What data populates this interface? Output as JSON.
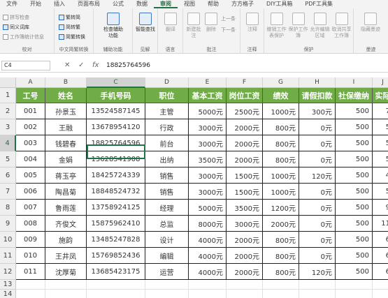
{
  "menu": {
    "tabs": [
      "文件",
      "开始",
      "插入",
      "页面布局",
      "公式",
      "数据",
      "审阅",
      "视图",
      "帮助",
      "方方格子",
      "DIY工具箱",
      "PDF工具集"
    ],
    "active": "审阅"
  },
  "ribbon": {
    "proofing": {
      "items": [
        "拼写检查",
        "同义词库",
        "工作簿统计信息"
      ],
      "label": "校对"
    },
    "chinese_conversion": {
      "items": [
        "繁转简",
        "简转繁",
        "简繁转换"
      ],
      "label": "中文简繁转换"
    },
    "accessibility": {
      "button": "检查辅助功能",
      "label": "辅助功能"
    },
    "insights": {
      "button": "智能查找",
      "label": "见解"
    },
    "language": {
      "button": "翻译",
      "label": "语言"
    },
    "comments": {
      "buttons": [
        "新建批注",
        "删除",
        "上一条",
        "下一条"
      ],
      "label": "批注"
    },
    "notes": {
      "button": "注释",
      "label": "注释"
    },
    "protect": {
      "buttons": [
        "撤销工作表保护",
        "保护工作簿",
        "允许编辑区域",
        "取消共享工作簿"
      ],
      "label": "保护"
    },
    "ink": {
      "button": "隐藏墨迹",
      "label": "墨迹"
    }
  },
  "formula_bar": {
    "name_box": "C4",
    "fx_label": "fx",
    "value": "18825764596"
  },
  "grid": {
    "columns": [
      "A",
      "B",
      "C",
      "D",
      "E",
      "F",
      "G",
      "H",
      "I",
      "J"
    ],
    "selected_column": "C",
    "rows": [
      "1",
      "2",
      "3",
      "4",
      "5",
      "6",
      "7",
      "8",
      "9",
      "10",
      "11",
      "12",
      "13",
      "14"
    ],
    "selected_row": "4"
  },
  "table": {
    "headers": [
      "工号",
      "姓名",
      "手机号码",
      "职位",
      "基本工资",
      "岗位工资",
      "绩效",
      "请假扣款",
      "社保缴纳",
      "实际"
    ],
    "rows": [
      [
        "001",
        "孙景玉",
        "13524587145",
        "主管",
        "5000元",
        "2500元",
        "1000元",
        "300元",
        "500",
        "7"
      ],
      [
        "002",
        "王融",
        "13678954120",
        "行政",
        "3000元",
        "2000元",
        "800元",
        "0元",
        "500",
        "5"
      ],
      [
        "003",
        "钱碧春",
        "18825764596",
        "前台",
        "3000元",
        "2000元",
        "800元",
        "0元",
        "500",
        "5"
      ],
      [
        "004",
        "金娟",
        "13628541908",
        "出纳",
        "3500元",
        "2000元",
        "800元",
        "0元",
        "500",
        "5"
      ],
      [
        "005",
        "蒋玉亭",
        "18425724339",
        "销售",
        "3000元",
        "1500元",
        "1000元",
        "120元",
        "500",
        "4"
      ],
      [
        "006",
        "陶昌菊",
        "18848524732",
        "销售",
        "3000元",
        "1500元",
        "1000元",
        "0元",
        "500",
        "5"
      ],
      [
        "007",
        "鲁雨莲",
        "13758924125",
        "经理",
        "5000元",
        "3500元",
        "1200元",
        "0元",
        "500",
        "9"
      ],
      [
        "008",
        "齐俊文",
        "15875962410",
        "总监",
        "8000元",
        "3000元",
        "2000元",
        "0元",
        "500",
        "11"
      ],
      [
        "009",
        "施韵",
        "13485247828",
        "设计",
        "4000元",
        "2000元",
        "800元",
        "0元",
        "500",
        "6"
      ],
      [
        "010",
        "王井凤",
        "15769852436",
        "编辑",
        "4000元",
        "2000元",
        "800元",
        "0元",
        "500",
        "6"
      ],
      [
        "011",
        "沈厚菊",
        "13685423175",
        "运营",
        "4000元",
        "2000元",
        "800元",
        "120元",
        "500",
        "6"
      ]
    ]
  }
}
